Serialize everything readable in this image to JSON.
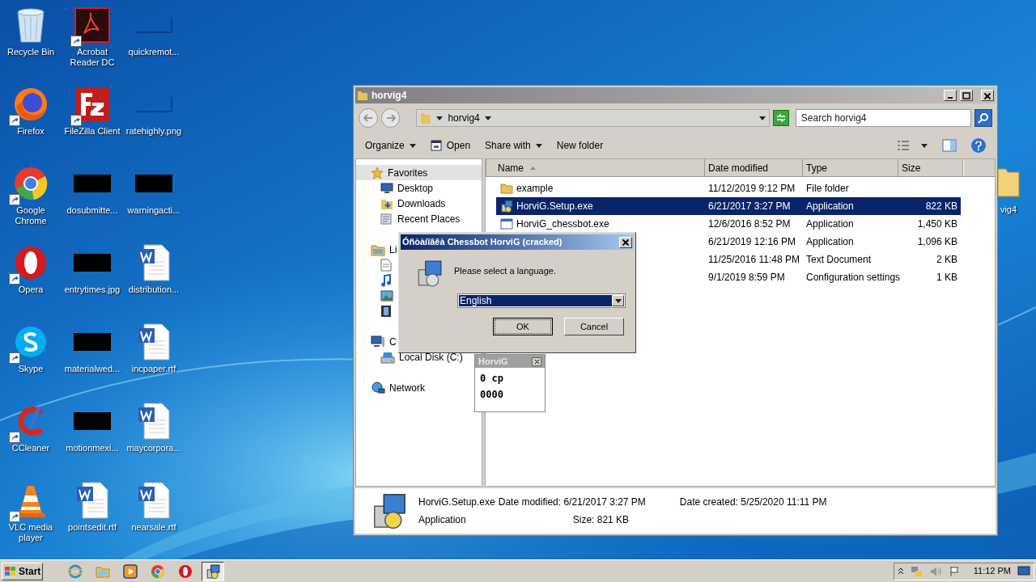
{
  "desktop": {
    "icons": [
      {
        "label": "Recycle Bin",
        "kind": "recycle",
        "shortcut": false
      },
      {
        "label": "Firefox",
        "kind": "firefox",
        "shortcut": true
      },
      {
        "label": "Google Chrome",
        "kind": "chrome",
        "shortcut": true
      },
      {
        "label": "Opera",
        "kind": "opera",
        "shortcut": true
      },
      {
        "label": "Skype",
        "kind": "skype",
        "shortcut": true
      },
      {
        "label": "CCleaner",
        "kind": "ccleaner",
        "shortcut": true
      },
      {
        "label": "VLC media player",
        "kind": "vlc",
        "shortcut": true
      },
      {
        "label": "Acrobat Reader DC",
        "kind": "acrobat",
        "shortcut": true
      },
      {
        "label": "FileZilla Client",
        "kind": "filezilla",
        "shortcut": true
      },
      {
        "label": "dosubmitte...",
        "kind": "redacted",
        "shortcut": false
      },
      {
        "label": "entrytimes.jpg",
        "kind": "redacted",
        "shortcut": false
      },
      {
        "label": "materialwed...",
        "kind": "redacted",
        "shortcut": false
      },
      {
        "label": "motionmexi...",
        "kind": "redacted",
        "shortcut": false
      },
      {
        "label": "pointsedit.rtf",
        "kind": "word",
        "shortcut": false
      },
      {
        "label": "quickremot...",
        "kind": "blank",
        "shortcut": false
      },
      {
        "label": "ratehighly.png",
        "kind": "blank",
        "shortcut": false
      },
      {
        "label": "warningacti...",
        "kind": "redacted",
        "shortcut": false
      },
      {
        "label": "distribution...",
        "kind": "word",
        "shortcut": false
      },
      {
        "label": "incpaper.rtf",
        "kind": "word",
        "shortcut": false
      },
      {
        "label": "maycorpora...",
        "kind": "word",
        "shortcut": false
      },
      {
        "label": "nearsale.rtf",
        "kind": "word",
        "shortcut": false
      }
    ],
    "hidden_icon": {
      "label": "vig4"
    }
  },
  "explorer": {
    "title": "horvig4",
    "breadcrumb": "horvig4",
    "search": {
      "placeholder": "Search horvig4"
    },
    "toolbar": [
      {
        "label": "Organize",
        "dropdown": true,
        "kind": "text"
      },
      {
        "label": "Open",
        "dropdown": false,
        "kind": "open"
      },
      {
        "label": "Share with",
        "dropdown": true,
        "kind": "text"
      },
      {
        "label": "New folder",
        "dropdown": false,
        "kind": "text"
      }
    ],
    "nav": [
      {
        "label": "Favorites",
        "kind": "star",
        "selected": true,
        "children": [
          {
            "label": "Desktop",
            "kind": "desktop"
          },
          {
            "label": "Downloads",
            "kind": "downloads"
          },
          {
            "label": "Recent Places",
            "kind": "recent"
          }
        ]
      },
      {
        "label": "Li",
        "kind": "library",
        "selected": false,
        "children": [
          {
            "kind": "doc"
          },
          {
            "kind": "music"
          },
          {
            "kind": "pictures"
          },
          {
            "kind": "video"
          }
        ]
      },
      {
        "label": "C",
        "kind": "computer",
        "selected": false,
        "children": [
          {
            "label": "Local Disk (C:)",
            "kind": "disk"
          }
        ]
      },
      {
        "label": "Network",
        "kind": "network",
        "selected": false
      }
    ],
    "columns": [
      "Name",
      "Date modified",
      "Type",
      "Size"
    ],
    "rows": [
      {
        "name": "example",
        "date": "11/12/2019 9:12 PM",
        "type": "File folder",
        "kind": "folder",
        "selected": false
      },
      {
        "name": "HorviG.Setup.exe",
        "date": "6/21/2017 3:27 PM",
        "type": "Application",
        "size": "822 KB",
        "kind": "setup",
        "selected": true
      },
      {
        "name": "HorviG_chessbot.exe",
        "date": "12/6/2016 8:52 PM",
        "type": "Application",
        "size": "1,450 KB",
        "kind": "app",
        "selected": false
      },
      {
        "date": "6/21/2019 12:16 PM",
        "type": "Application",
        "size": "1,096 KB",
        "selected": false
      },
      {
        "date": "11/25/2016 11:48 PM",
        "type": "Text Document",
        "size": "2 KB",
        "selected": false
      },
      {
        "date": "9/1/2019 8:59 PM",
        "type": "Configuration settings",
        "size": "1 KB",
        "selected": false
      }
    ],
    "details": {
      "name": "HorviG.Setup.exe",
      "type": "Application",
      "modified": "Date modified: 6/21/2017 3:27 PM",
      "size": "Size: 821 KB",
      "created": "Date created: 5/25/2020 11:11 PM"
    }
  },
  "dialog": {
    "title": "Óñòàíîâêà Chessbot HorviG (cracked)",
    "message": "Please select a language.",
    "language": "English",
    "buttons": [
      "OK",
      "Cancel"
    ]
  },
  "mini": {
    "title": "HorviG",
    "lines": [
      "0 cp",
      "0000"
    ]
  },
  "taskbar": {
    "start": "Start",
    "apps": [
      {
        "kind": "ie",
        "selected": false
      },
      {
        "kind": "explorer",
        "selected": false
      },
      {
        "kind": "media",
        "selected": false
      },
      {
        "kind": "chrome",
        "selected": false
      },
      {
        "kind": "opera",
        "selected": false
      },
      {
        "kind": "setup",
        "selected": true
      }
    ],
    "time": "11:12 PM"
  }
}
